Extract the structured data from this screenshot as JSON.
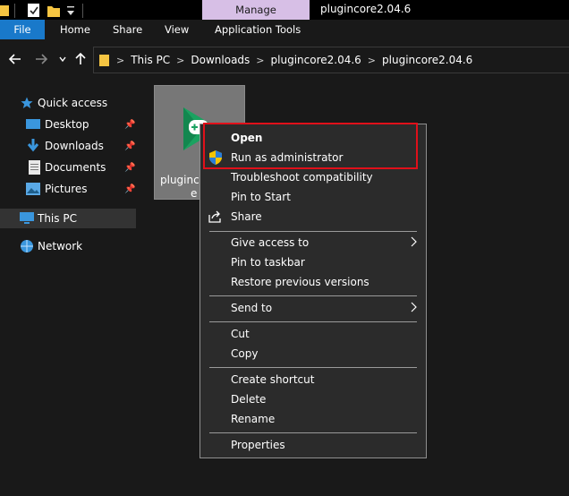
{
  "titlebar": {
    "window_title": "plugincore2.04.6",
    "context_tab": "Manage",
    "context_tab_color": "#d7bfe6",
    "quick_access_icons": [
      "folder-icon",
      "properties-checkmark-icon",
      "new-folder-icon",
      "customize-dropdown-icon"
    ]
  },
  "ribbon": {
    "tabs": [
      {
        "label": "File",
        "active": true,
        "color": "#1979ca"
      },
      {
        "label": "Home"
      },
      {
        "label": "Share"
      },
      {
        "label": "View"
      },
      {
        "label": "Application Tools"
      }
    ]
  },
  "address": {
    "breadcrumbs": [
      "This PC",
      "Downloads",
      "plugincore2.04.6",
      "plugincore2.04.6"
    ]
  },
  "navpane": {
    "quick_access": "Quick access",
    "items": [
      {
        "label": "Desktop",
        "pinned": true,
        "icon": "desktop-icon"
      },
      {
        "label": "Downloads",
        "pinned": true,
        "icon": "download-icon"
      },
      {
        "label": "Documents",
        "pinned": true,
        "icon": "documents-icon"
      },
      {
        "label": "Pictures",
        "pinned": true,
        "icon": "pictures-icon"
      }
    ],
    "this_pc": "This PC",
    "network": "Network",
    "selected": "This PC"
  },
  "file": {
    "name_visible": "plugincore",
    "ext_visible": "e",
    "icon": "green-play-gamepad-icon",
    "selected": true
  },
  "context_menu": {
    "highlight_color": "#e0101a",
    "groups": [
      [
        {
          "label": "Open",
          "bold": true
        },
        {
          "label": "Run as administrator",
          "icon": "uac-shield-icon"
        },
        {
          "label": "Troubleshoot compatibility"
        },
        {
          "label": "Pin to Start"
        },
        {
          "label": "Share",
          "icon": "share-icon"
        }
      ],
      [
        {
          "label": "Give access to",
          "submenu": true
        },
        {
          "label": "Pin to taskbar"
        },
        {
          "label": "Restore previous versions"
        }
      ],
      [
        {
          "label": "Send to",
          "submenu": true
        }
      ],
      [
        {
          "label": "Cut"
        },
        {
          "label": "Copy"
        }
      ],
      [
        {
          "label": "Create shortcut"
        },
        {
          "label": "Delete"
        },
        {
          "label": "Rename"
        }
      ],
      [
        {
          "label": "Properties"
        }
      ]
    ]
  }
}
